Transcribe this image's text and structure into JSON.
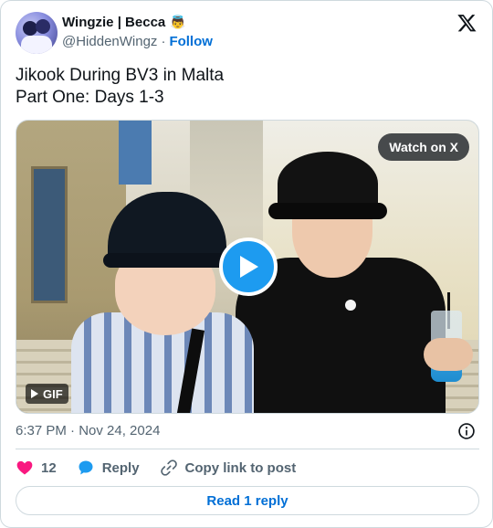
{
  "author": {
    "display_name": "Wingzie | Becca",
    "name_emoji": "👼",
    "handle": "@HiddenWingz",
    "separator": "·",
    "follow_label": "Follow"
  },
  "tweet": {
    "lines": [
      "Jikook During BV3 in Malta",
      "Part One: Days 1-3"
    ]
  },
  "media": {
    "watch_label": "Watch on X",
    "gif_label": "GIF",
    "play_icon": "play-icon"
  },
  "meta": {
    "timestamp": "6:37 PM · Nov 24, 2024"
  },
  "actions": {
    "like_count": "12",
    "reply_label": "Reply",
    "copy_label": "Copy link to post"
  },
  "read_reply_label": "Read 1 reply",
  "colors": {
    "accent": "#1d9bf0",
    "link": "#006fd6",
    "like": "#f91880",
    "muted": "#536471",
    "border": "#cfd9de"
  }
}
